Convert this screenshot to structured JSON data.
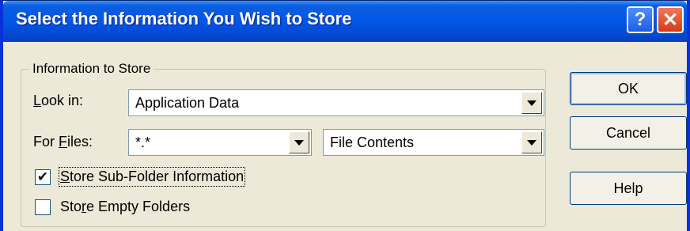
{
  "window": {
    "title": "Select the Information You Wish to Store",
    "help_glyph": "?",
    "close_glyph": "✕"
  },
  "group": {
    "legend": "Information to Store",
    "look_in": {
      "label_hotkey": "L",
      "label_rest": "ook in:",
      "value": "Application Data"
    },
    "for_files": {
      "label_pre": "For ",
      "label_hotkey": "F",
      "label_rest": "iles:",
      "pattern_value": "*.*",
      "type_value": "File Contents"
    },
    "store_subfolders": {
      "label_hotkey": "S",
      "label_rest": "tore Sub-Folder Information",
      "checked": true,
      "check_glyph": "✔"
    },
    "store_empty": {
      "label_pre": "Sto",
      "label_hotkey": "r",
      "label_rest": "e Empty Folders",
      "checked": false
    }
  },
  "buttons": {
    "ok": "OK",
    "cancel": "Cancel",
    "help": "Help"
  },
  "colors": {
    "titlebar": "#0356e8",
    "dialog_bg": "#ece9d8",
    "close_button": "#d83a14"
  }
}
